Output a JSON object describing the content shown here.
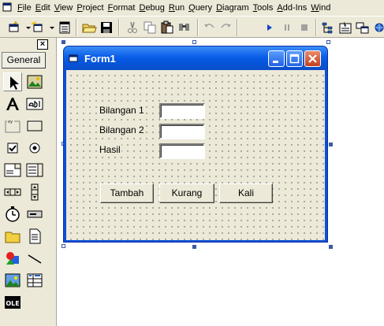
{
  "menubar": {
    "items": [
      "File",
      "Edit",
      "View",
      "Project",
      "Format",
      "Debug",
      "Run",
      "Query",
      "Diagram",
      "Tools",
      "Add-Ins",
      "Wind"
    ]
  },
  "toolbox": {
    "tab_label": "General",
    "close_glyph": "×",
    "tools": [
      "pointer-icon",
      "picturebox-icon",
      "label-icon",
      "textbox-icon",
      "frame-icon",
      "commandbutton-icon",
      "checkbox-icon",
      "optionbutton-icon",
      "combobox-icon",
      "listbox-icon",
      "hscrollbar-icon",
      "vscrollbar-icon",
      "timer-icon",
      "drivelistbox-icon",
      "dirlistbox-icon",
      "filelistbox-icon",
      "shape-icon",
      "line-icon",
      "image-icon",
      "data-icon",
      "ole-icon"
    ],
    "ole_text": "OLE"
  },
  "form": {
    "title": "Form1",
    "labels": {
      "bilangan1": "Bilangan 1",
      "bilangan2": "Bilangan 2",
      "hasil": "Hasil"
    },
    "buttons": {
      "tambah": "Tambah",
      "kurang": "Kurang",
      "kali": "Kali"
    }
  },
  "colors": {
    "titlebar": "#0a5de8",
    "form_bg": "#ece9d8",
    "selection_handle": "#3b5aa6"
  }
}
